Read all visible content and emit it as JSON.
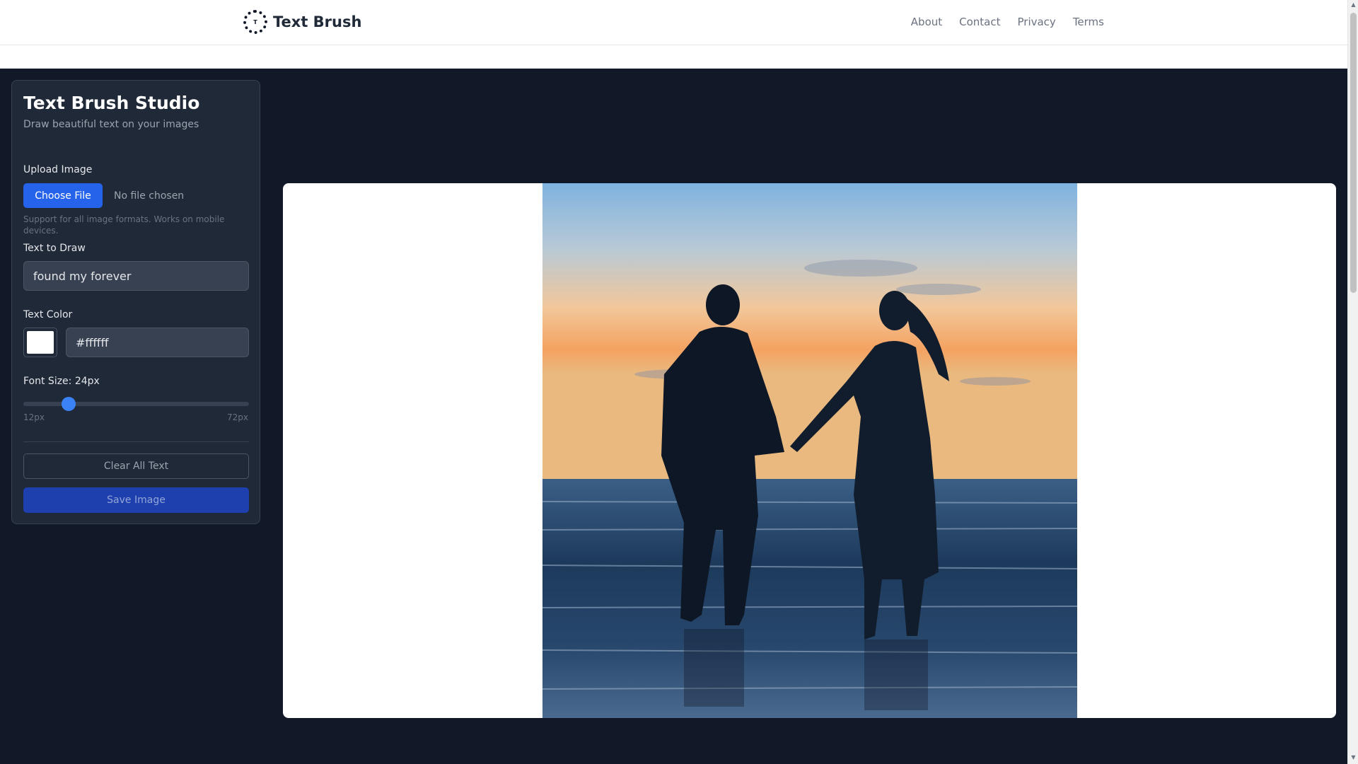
{
  "header": {
    "brand_name": "Text Brush",
    "logo_icon": "circular-text-logo",
    "nav": [
      {
        "label": "About"
      },
      {
        "label": "Contact"
      },
      {
        "label": "Privacy"
      },
      {
        "label": "Terms"
      }
    ]
  },
  "panel": {
    "title": "Text Brush Studio",
    "subtitle": "Draw beautiful text on your images",
    "upload": {
      "label": "Upload Image",
      "button_label": "Choose File",
      "status": "No file chosen",
      "help": "Support for all image formats. Works on mobile devices."
    },
    "text": {
      "label": "Text to Draw",
      "value": "found my forever"
    },
    "color": {
      "label": "Text Color",
      "value": "#ffffff",
      "swatch": "#ffffff"
    },
    "font_size": {
      "label": "Font Size: 24px",
      "min_label": "12px",
      "max_label": "72px",
      "min": 12,
      "max": 72,
      "value": 24
    },
    "clear_label": "Clear All Text",
    "save_label": "Save Image"
  },
  "canvas": {
    "image_subject": "silhouette-couple-holding-hands-beach-sunset"
  },
  "colors": {
    "accent": "#2563eb",
    "app_bg": "#111827",
    "panel_bg": "#1f2937"
  }
}
